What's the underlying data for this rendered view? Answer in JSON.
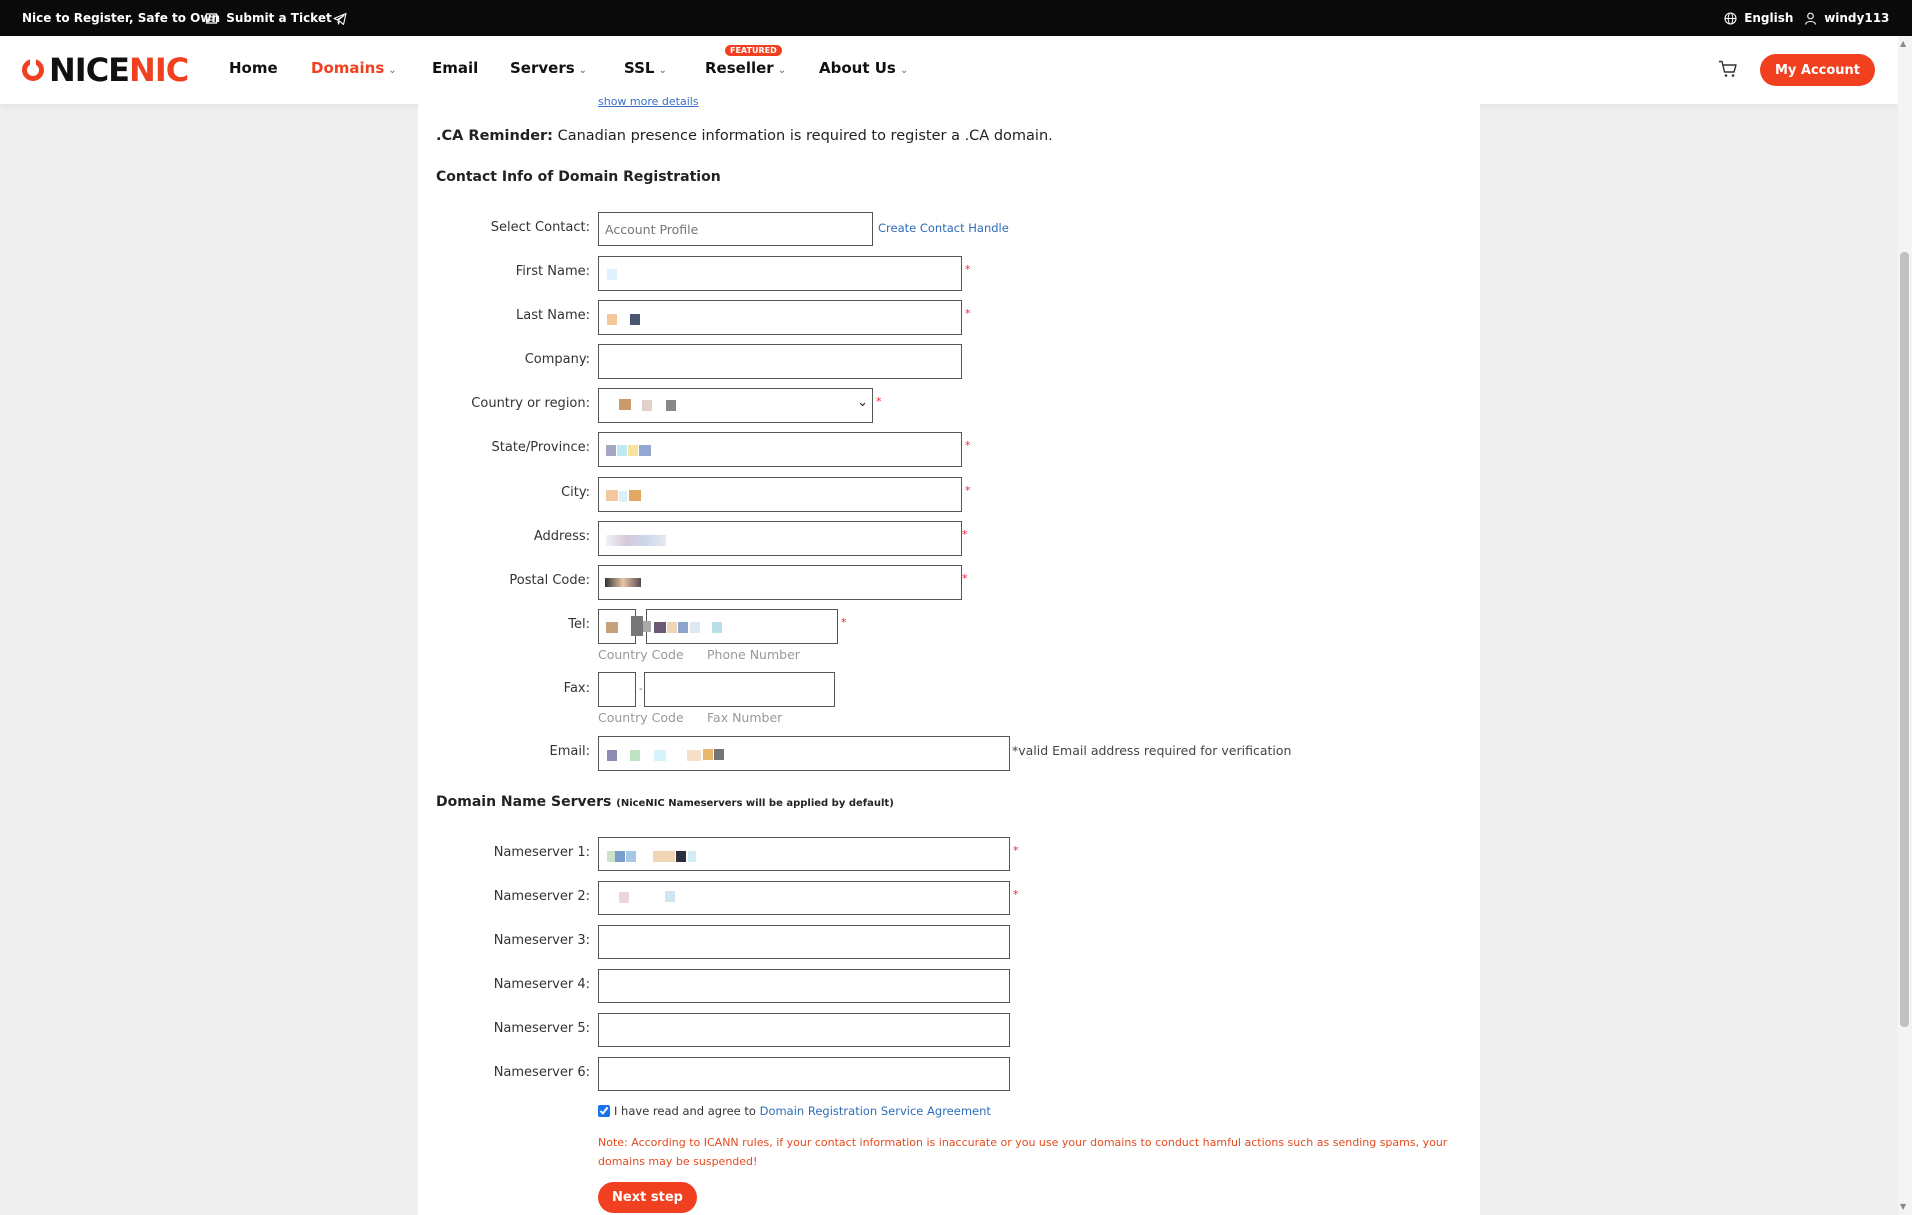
{
  "topbar": {
    "slogan": "Nice to Register, Safe to Own",
    "ticket": "Submit a Ticket",
    "language": "English",
    "username": "windy113"
  },
  "brand": {
    "logo_text": "NICENIC",
    "accent": "#f0401f"
  },
  "nav": {
    "items": [
      {
        "label": "Home"
      },
      {
        "label": "Domains"
      },
      {
        "label": "Email"
      },
      {
        "label": "Servers"
      },
      {
        "label": "SSL"
      },
      {
        "label": "Reseller"
      },
      {
        "label": "About Us"
      }
    ],
    "featured_badge": "FEATURED",
    "account_button": "My Account"
  },
  "page": {
    "more_details_link": "show more details",
    "reminder_bold": ".CA Reminder:",
    "reminder_text": " Canadian presence information is required to register a .CA domain.",
    "contact_section_title": "Contact Info of Domain Registration",
    "contact": {
      "select_contact_label": "Select Contact:",
      "select_contact_placeholder": "Account Profile",
      "create_handle_link": "Create Contact Handle",
      "first_name_label": "First Name:",
      "last_name_label": "Last Name:",
      "company_label": "Company:",
      "country_label": "Country or region:",
      "state_label": "State/Province:",
      "city_label": "City:",
      "address_label": "Address:",
      "postal_label": "Postal Code:",
      "tel_label": "Tel:",
      "tel_country_hint": "Country Code",
      "tel_number_hint": "Phone Number",
      "fax_label": "Fax:",
      "fax_country_hint": "Country Code",
      "fax_number_hint": "Fax Number",
      "email_label": "Email:",
      "email_note": "*valid Email address required for verification"
    },
    "ns_section_title": "Domain Name Servers",
    "ns_section_note": "(NiceNIC Nameservers will be applied by default)",
    "nameservers": [
      {
        "label": "Nameserver 1:"
      },
      {
        "label": "Nameserver 2:"
      },
      {
        "label": "Nameserver 3:"
      },
      {
        "label": "Nameserver 4:"
      },
      {
        "label": "Nameserver 5:"
      },
      {
        "label": "Nameserver 6:"
      }
    ],
    "agree_text": "I have read and agree to ",
    "agree_link": "Domain Registration Service Agreement",
    "agree_checked": true,
    "note": "Note: According to ICANN rules, if your contact information is inaccurate or you use your domains to conduct hamful actions such as sending spams, your domains may be suspended!",
    "next_button": "Next step"
  }
}
